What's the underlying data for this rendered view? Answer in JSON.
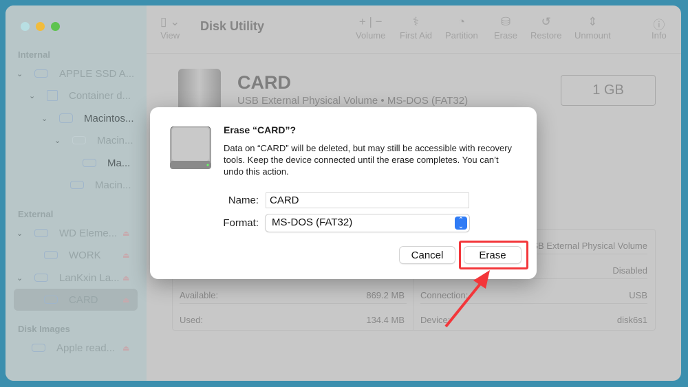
{
  "window": {
    "title": "Disk Utility"
  },
  "toolbar": {
    "view": "View",
    "volume": "Volume",
    "first_aid": "First Aid",
    "partition": "Partition",
    "erase": "Erase",
    "restore": "Restore",
    "unmount": "Unmount",
    "info": "Info"
  },
  "sidebar": {
    "internal": "Internal",
    "external": "External",
    "disk_images": "Disk Images",
    "items": [
      {
        "label": "APPLE SSD A..."
      },
      {
        "label": "Container d..."
      },
      {
        "label": "Macintos..."
      },
      {
        "label": "Macin..."
      },
      {
        "label": "Ma..."
      },
      {
        "label": "Macin..."
      },
      {
        "label": "WD Eleme..."
      },
      {
        "label": "WORK"
      },
      {
        "label": "LanKxin La..."
      },
      {
        "label": "CARD"
      },
      {
        "label": "Apple read..."
      }
    ]
  },
  "volume": {
    "name": "CARD",
    "subtitle": "USB External Physical Volume • MS-DOS (FAT32)",
    "size": "1 GB"
  },
  "info": {
    "available_label": "Available:",
    "available": "869.2 MB",
    "used_label": "Used:",
    "used": "134.4 MB",
    "type_value": "USB External Physical Volume",
    "owners_value": "Disabled",
    "connection_label": "Connection:",
    "connection": "USB",
    "device_label": "Device:",
    "device": "disk6s1"
  },
  "dialog": {
    "title": "Erase “CARD”?",
    "message": "Data on “CARD” will be deleted, but may still be accessible with recovery tools. Keep the device connected until the erase completes. You can’t undo this action.",
    "name_label": "Name:",
    "name_value": "CARD",
    "format_label": "Format:",
    "format_value": "MS-DOS (FAT32)",
    "cancel": "Cancel",
    "erase": "Erase"
  },
  "colors": {
    "annotation": "#f3363a",
    "accent": "#2f7bf5"
  }
}
